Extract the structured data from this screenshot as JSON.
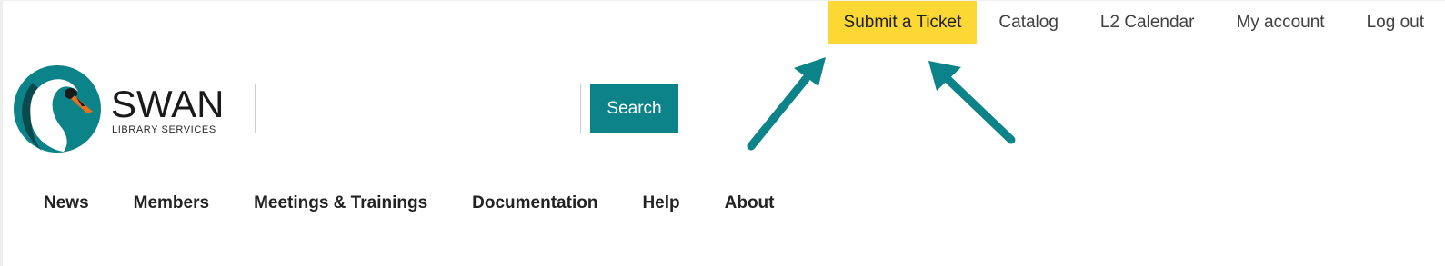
{
  "top_nav": {
    "items": [
      {
        "label": "Submit a Ticket",
        "highlighted": true
      },
      {
        "label": "Catalog"
      },
      {
        "label": "L2 Calendar"
      },
      {
        "label": "My account"
      },
      {
        "label": "Log out"
      }
    ]
  },
  "logo": {
    "name": "SWAN",
    "subtitle": "LIBRARY SERVICES",
    "icon": "swan-icon"
  },
  "search": {
    "value": "",
    "placeholder": "",
    "button_label": "Search"
  },
  "main_nav": {
    "items": [
      {
        "label": "News"
      },
      {
        "label": "Members"
      },
      {
        "label": "Meetings & Trainings"
      },
      {
        "label": "Documentation"
      },
      {
        "label": "Help"
      },
      {
        "label": "About"
      }
    ]
  },
  "annotations": {
    "arrow_count": 2,
    "arrow_icon": "arrow-up-icon"
  },
  "colors": {
    "accent_teal": "#0b8389",
    "highlight_yellow": "#fdd835",
    "text_dark": "#222222",
    "text_muted": "#404040"
  }
}
